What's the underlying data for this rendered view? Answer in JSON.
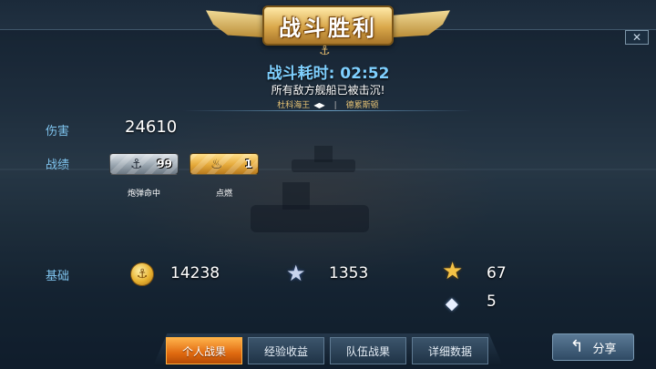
{
  "header": {
    "title": "战斗胜利"
  },
  "close_label": "✕",
  "battle": {
    "duration_label": "战斗耗时: 02:52",
    "result_message": "所有敌方舰船已被击沉!",
    "player_ship": "杜科海王",
    "enemy_ship": "德累斯顿"
  },
  "stats": {
    "damage_label": "伤害",
    "damage_value": "24610",
    "achievements_label": "战绩",
    "achievements": [
      {
        "label": "炮弹命中",
        "count": "99",
        "icon": "anchor-shell-icon"
      },
      {
        "label": "点燃",
        "count": "1",
        "icon": "fire-icon"
      }
    ]
  },
  "base": {
    "label": "基础",
    "gold": "14238",
    "exp": "1353",
    "star_points": "67",
    "diamonds": "5"
  },
  "tabs": [
    {
      "label": "个人战果",
      "active": true
    },
    {
      "label": "经验收益",
      "active": false
    },
    {
      "label": "队伍战果",
      "active": false
    },
    {
      "label": "详细数据",
      "active": false
    }
  ],
  "share": {
    "label": "分享"
  },
  "colors": {
    "accent_blue": "#7fc4ee",
    "tab_active": "#e06a10",
    "gold": "#e8b230"
  }
}
